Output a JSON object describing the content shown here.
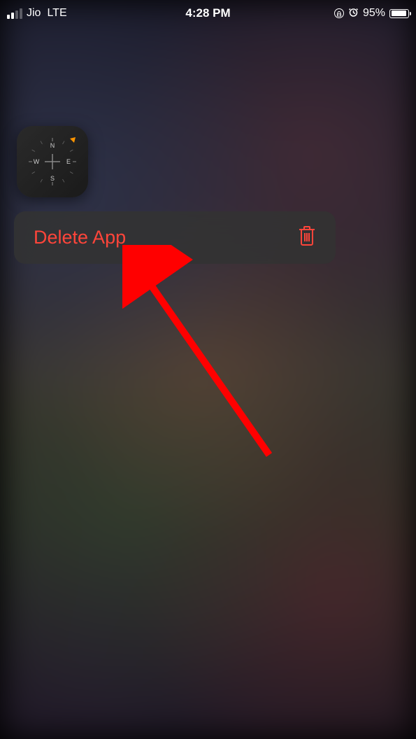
{
  "status_bar": {
    "carrier": "Jio",
    "network_type": "LTE",
    "time": "4:28 PM",
    "battery_pct": "95%"
  },
  "context_menu": {
    "delete_label": "Delete App"
  },
  "app": {
    "name": "Compass"
  },
  "colors": {
    "destructive": "#ff453a"
  }
}
